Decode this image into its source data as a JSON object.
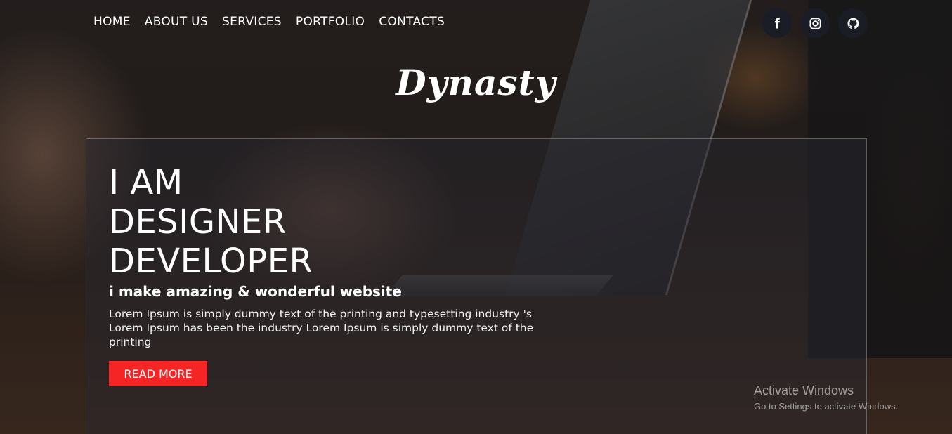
{
  "nav": {
    "items": [
      {
        "label": "HOME"
      },
      {
        "label": "ABOUT US"
      },
      {
        "label": "SERVICES"
      },
      {
        "label": "PORTFOLIO"
      },
      {
        "label": "CONTACTS"
      }
    ]
  },
  "social": {
    "icons": [
      "facebook-icon",
      "instagram-icon",
      "github-icon"
    ]
  },
  "logo": {
    "text": "Dynasty"
  },
  "hero": {
    "headline": [
      "I AM",
      "DESIGNER",
      "DEVELOPER"
    ],
    "tagline": "i make amazing & wonderful website",
    "description": "Lorem Ipsum is simply dummy text of the printing and typesetting industry 's Lorem Ipsum has been the industry Lorem Ipsum is simply dummy text of the printing",
    "button_label": "READ MORE"
  },
  "watermark": {
    "title": "Activate Windows",
    "subtitle": "Go to Settings to activate Windows."
  },
  "colors": {
    "accent": "#f52525",
    "social_bg": "#1b1d26"
  }
}
